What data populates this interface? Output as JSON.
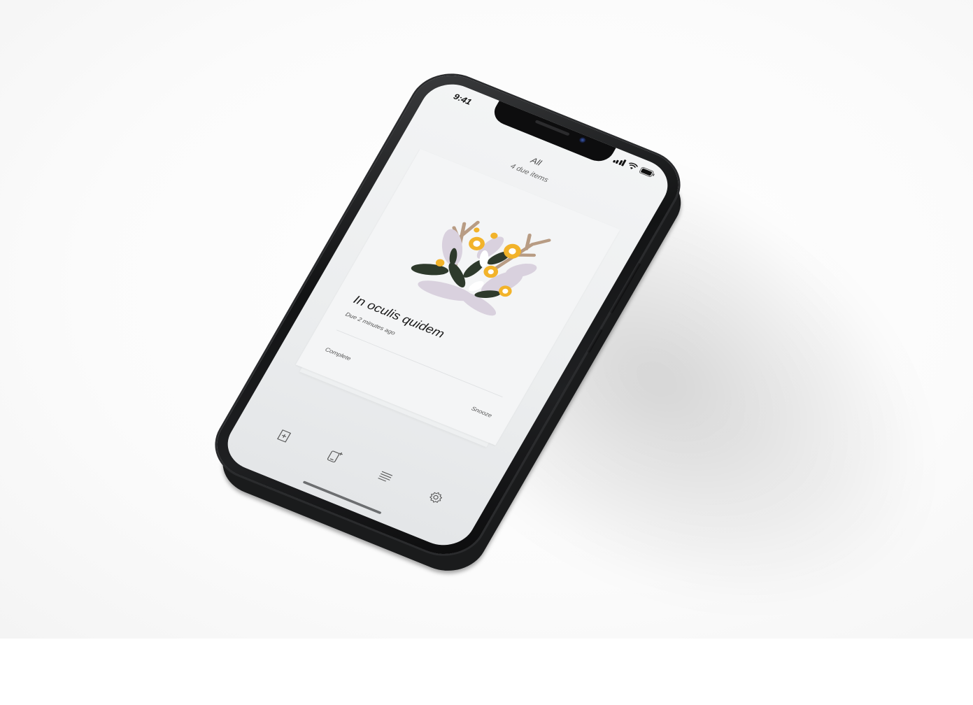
{
  "status_bar": {
    "time": "9:41",
    "icons": [
      "cellular-signal-icon",
      "wifi-icon",
      "battery-icon"
    ]
  },
  "header": {
    "title": "All",
    "subtitle": "4 due items"
  },
  "card": {
    "illustration": "floral-illustration",
    "title": "In oculis quidem",
    "due": "Due 2 minutes ago",
    "actions": {
      "complete": "Complete",
      "snooze": "Snooze"
    }
  },
  "tabbar": {
    "items": [
      "add-card-icon",
      "new-device-icon",
      "list-icon",
      "settings-icon"
    ]
  },
  "colors": {
    "accent_yellow": "#f2b32a",
    "leaf_dark": "#2e3a2c",
    "petal_lilac": "#d9d1de",
    "branch_tan": "#b89c84"
  }
}
